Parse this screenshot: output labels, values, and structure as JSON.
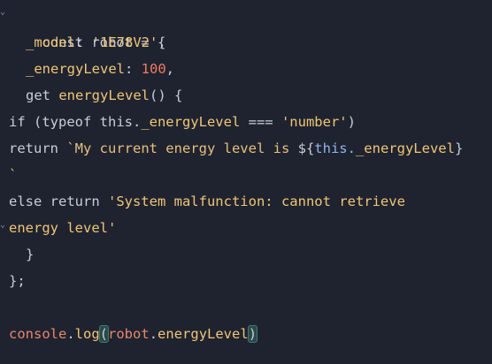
{
  "code": {
    "l1": {
      "a": "const robot = {"
    },
    "l2": {
      "prop": "_model",
      "colon": ": ",
      "val": "'1E78V2'",
      "end": ","
    },
    "l3": {
      "prop": "_energyLevel",
      "colon": ": ",
      "val": "100",
      "end": ","
    },
    "l4": {
      "kw": "get ",
      "fn": "energyLevel",
      "end": "() {"
    },
    "l5": {
      "a": "if (typeof this.",
      "prop": "_energyLevel",
      "b": " === ",
      "str": "'number'",
      "c": ")"
    },
    "l6": {
      "a": "return ",
      "tmpl": "`My current energy level is ",
      "interp_open": "${",
      "this": "this.",
      "prop": "_energyLevel",
      "interp_close": "}"
    },
    "l7": {
      "tmpl": "`"
    },
    "l8": {
      "a": "else return ",
      "str": "'System malfunction: cannot retrieve"
    },
    "l9": {
      "str": "energy level'"
    },
    "l10": {
      "a": "}"
    },
    "l11": {
      "a": "};"
    },
    "l12": {
      "obj1": "console",
      "dot1": ".",
      "fn1": "log",
      "paren_open": "(",
      "obj2": "robot",
      "dot2": ".",
      "fn2": "energyLevel",
      "paren_close": ")"
    }
  }
}
